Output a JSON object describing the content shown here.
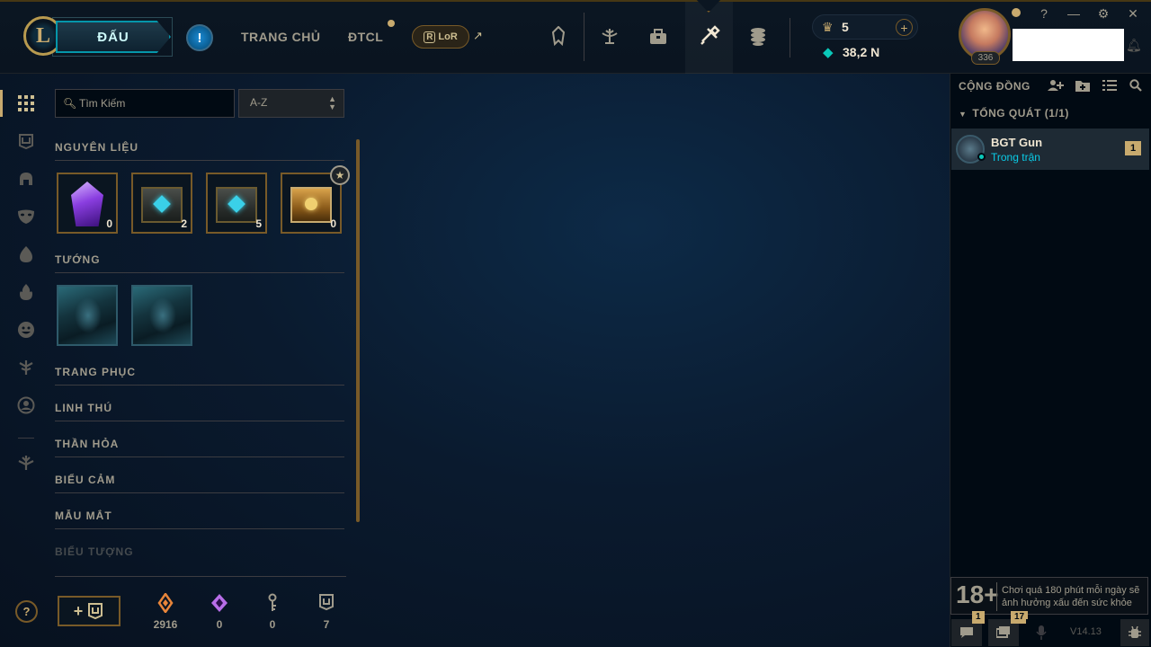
{
  "topbar": {
    "logo_letter": "L",
    "play_label": "ĐẤU",
    "alert_label": "!",
    "nav": [
      {
        "label": "TRANG CHỦ"
      },
      {
        "label": "ĐTCL"
      }
    ],
    "lor_label": "LoR",
    "lor_arrow": "↗",
    "icons": [
      "profile-icon",
      "collection-icon",
      "loot-icon",
      "crafting-icon",
      "store-icon"
    ],
    "currency": {
      "rp_value": "5",
      "be_value": "38,2 N",
      "plus": "+"
    },
    "profile": {
      "level": "336"
    },
    "window": {
      "help": "?",
      "minimize": "—",
      "settings": "⚙",
      "close": "✕"
    }
  },
  "inventory": {
    "search_placeholder": "Tìm Kiếm",
    "sort_value": "A-Z",
    "sections": {
      "materials": "NGUYÊN LIỆU",
      "champions": "TƯỚNG",
      "skins": "TRANG PHỤC",
      "companions": "LINH THÚ",
      "totems": "THẦN HỎA",
      "emotes": "BIỂU CẢM",
      "ward": "MẪU MẮT",
      "icons": "BIỂU TƯỢNG"
    },
    "materials": [
      {
        "name": "orange-essence-shard",
        "count": "0"
      },
      {
        "name": "hextech-chest",
        "count": "2"
      },
      {
        "name": "hextech-chest-2",
        "count": "5"
      },
      {
        "name": "masterwork-chest",
        "count": "0"
      }
    ],
    "champion_shards": [
      "champion-shard-1",
      "champion-shard-2"
    ]
  },
  "bottom": {
    "craft_plus": "+",
    "resources": [
      {
        "icon": "orange-essence-icon",
        "value": "2916",
        "color": "#e8853a"
      },
      {
        "icon": "mythic-essence-icon",
        "value": "0",
        "color": "#b86ee8"
      },
      {
        "icon": "key-fragment-icon",
        "value": "0",
        "color": "#a09b8c"
      },
      {
        "icon": "blue-essence-icon",
        "value": "7",
        "color": "#a09b8c"
      }
    ],
    "help": "?"
  },
  "social": {
    "title": "CỘNG ĐỒNG",
    "group": "TỔNG QUÁT (1/1)",
    "friend": {
      "name": "BGT Gun",
      "status": "Trong trận",
      "count": "1"
    },
    "age_rating": "18+",
    "age_notice": "Chơi quá 180 phút mỗi ngày sẽ ảnh hưởng xấu đến sức khỏe",
    "chat_badge": "1",
    "notif_badge": "17",
    "version": "V14.13"
  }
}
